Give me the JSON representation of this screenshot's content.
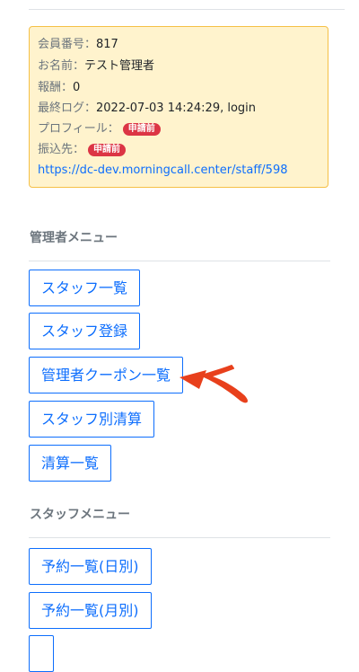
{
  "info_card": {
    "member_no": {
      "key": "会員番号：",
      "value": "817"
    },
    "name": {
      "key": "お名前：",
      "value": "テスト管理者"
    },
    "reward": {
      "key": "報酬：",
      "value": "0"
    },
    "last_log": {
      "key": "最終ログ：",
      "value": "2022-07-03 14:24:29, login"
    },
    "profile": {
      "key": "プロフィール：",
      "badge": "申請前"
    },
    "transfer": {
      "key": "振込先：",
      "badge": "申請前"
    },
    "url": "https://dc-dev.morningcall.center/staff/598"
  },
  "admin_menu": {
    "title": "管理者メニュー",
    "items": [
      "スタッフ一覧",
      "スタッフ登録",
      "管理者クーポン一覧",
      "スタッフ別清算",
      "清算一覧"
    ]
  },
  "staff_menu": {
    "title": "スタッフメニュー",
    "items": [
      "予約一覧(日別)",
      "予約一覧(月別)"
    ]
  },
  "colors": {
    "accent": "#0d6efd",
    "card_bg": "#fff3cd",
    "card_border": "#f5c047",
    "badge_bg": "#dc3545",
    "annotation_arrow": "#e8401c"
  }
}
